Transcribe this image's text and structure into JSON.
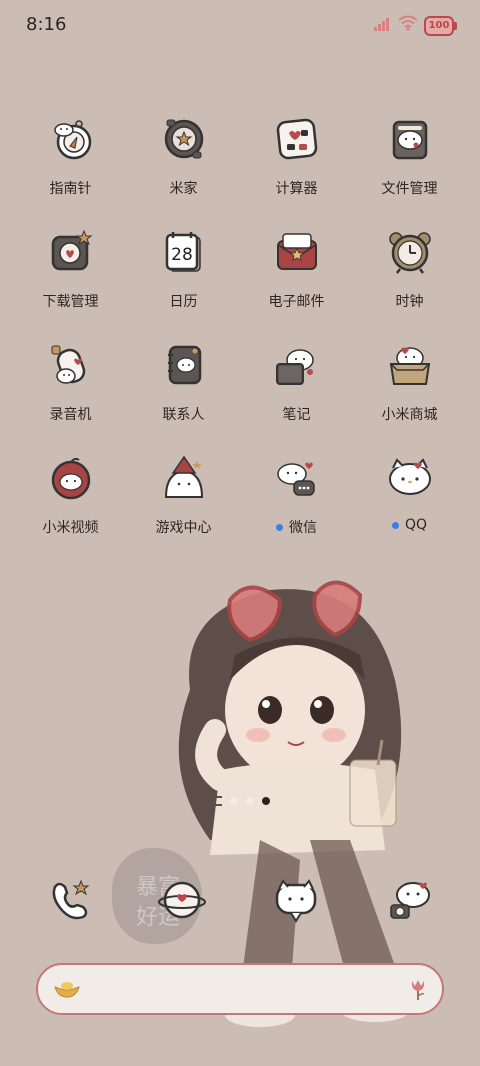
{
  "status_bar": {
    "time": "8:16",
    "battery": "100"
  },
  "apps": [
    {
      "label": "指南针",
      "icon": "compass-icon"
    },
    {
      "label": "米家",
      "icon": "mijia-icon"
    },
    {
      "label": "计算器",
      "icon": "calculator-icon"
    },
    {
      "label": "文件管理",
      "icon": "file-manager-icon"
    },
    {
      "label": "下载管理",
      "icon": "download-icon"
    },
    {
      "label": "日历",
      "icon": "calendar-icon",
      "badge": "28"
    },
    {
      "label": "电子邮件",
      "icon": "email-icon"
    },
    {
      "label": "时钟",
      "icon": "clock-icon"
    },
    {
      "label": "录音机",
      "icon": "recorder-icon"
    },
    {
      "label": "联系人",
      "icon": "contacts-icon"
    },
    {
      "label": "笔记",
      "icon": "notes-icon"
    },
    {
      "label": "小米商城",
      "icon": "mi-store-icon"
    },
    {
      "label": "小米视频",
      "icon": "mi-video-icon"
    },
    {
      "label": "游戏中心",
      "icon": "game-center-icon"
    },
    {
      "label": "微信",
      "icon": "wechat-icon",
      "new": true
    },
    {
      "label": "QQ",
      "icon": "qq-icon",
      "new": true
    }
  ],
  "dock": [
    {
      "name": "phone",
      "icon": "phone-icon"
    },
    {
      "name": "browser",
      "icon": "browser-icon"
    },
    {
      "name": "messages",
      "icon": "messages-icon"
    },
    {
      "name": "camera",
      "icon": "camera-icon"
    }
  ],
  "watermark": "暴富好运",
  "colors": {
    "background": "#cbbdb4",
    "accent_red": "#b74a4a",
    "new_dot": "#3d7de6"
  }
}
